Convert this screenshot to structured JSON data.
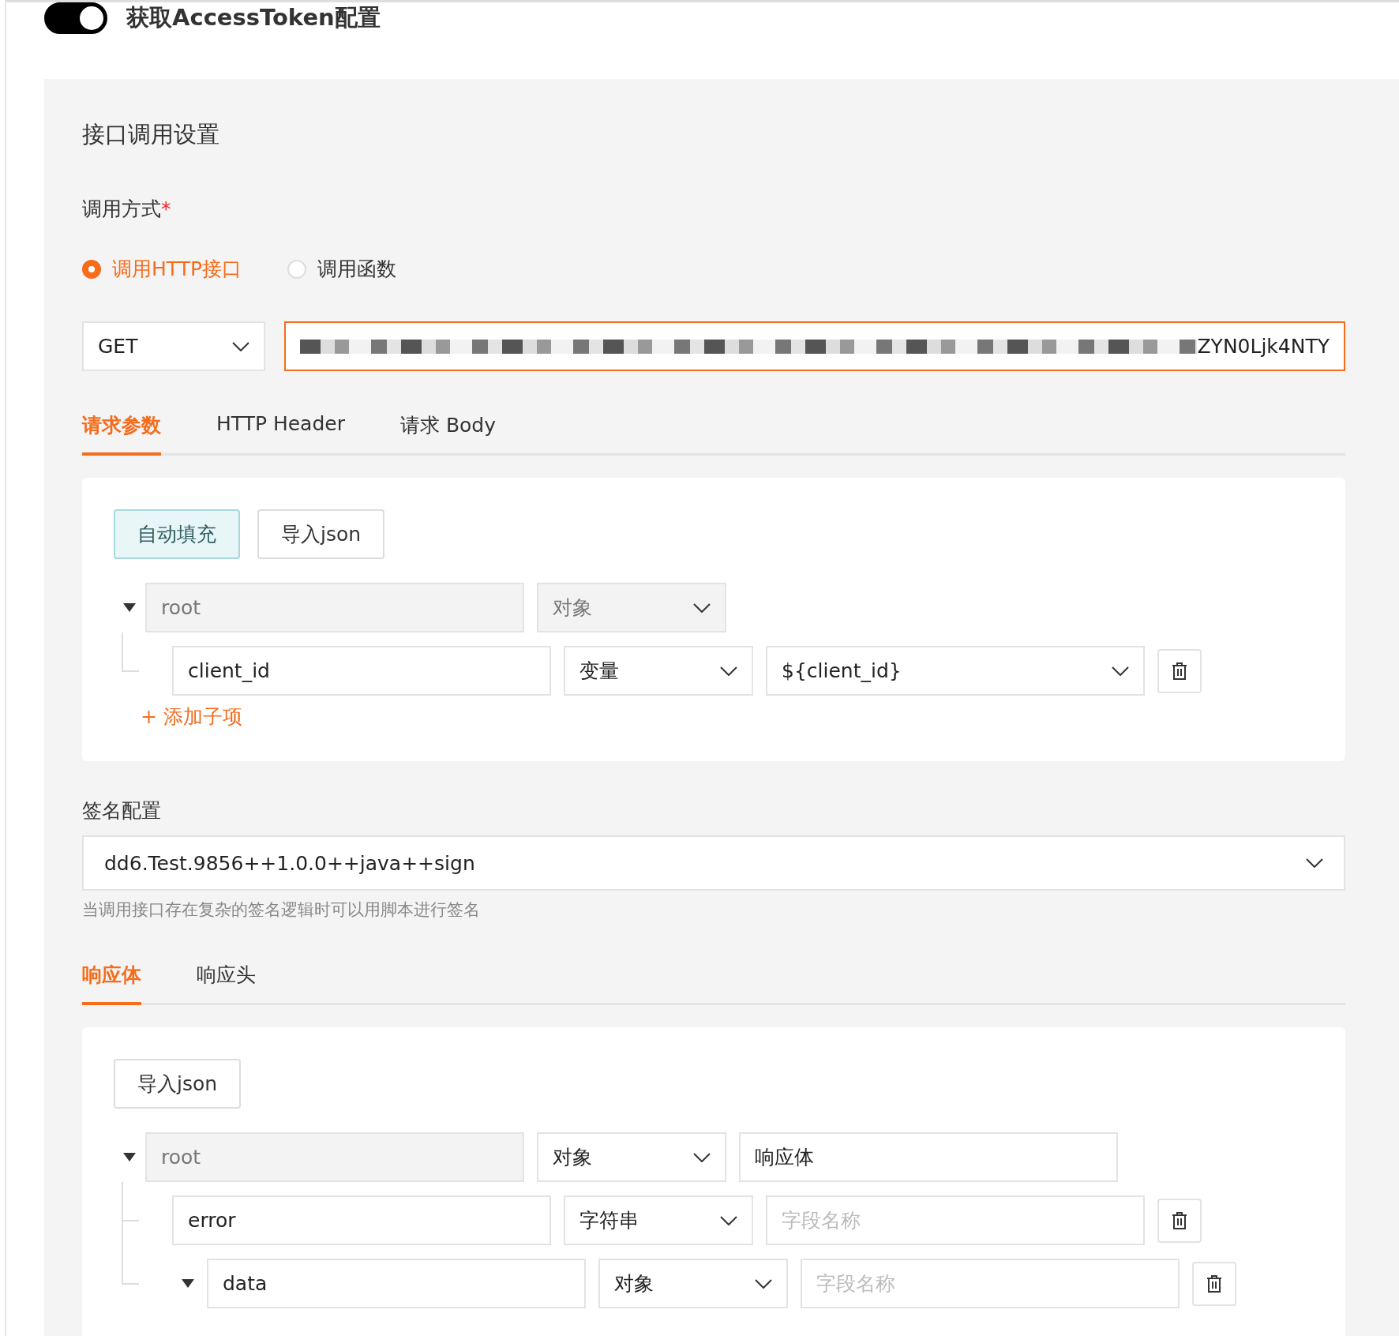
{
  "toggle": {
    "on": true,
    "label": "获取AccessToken配置"
  },
  "panel": {
    "title": "接口调用设置",
    "call_mode": {
      "label": "调用方式",
      "required_mark": "*",
      "options": [
        {
          "label": "调用HTTP接口",
          "selected": true
        },
        {
          "label": "调用函数",
          "selected": false
        }
      ]
    },
    "method": "GET",
    "url": {
      "value": "ZYN0Ljk4NTY",
      "focused": true
    },
    "request_tabs": [
      {
        "label": "请求参数",
        "selected": true
      },
      {
        "label": "HTTP Header",
        "selected": false
      },
      {
        "label": "请求 Body",
        "selected": false
      }
    ],
    "request_params": {
      "buttons": [
        {
          "label": "自动填充",
          "kind": "primary"
        },
        {
          "label": "导入json",
          "kind": "default"
        }
      ],
      "tree": {
        "name": "root",
        "name_disabled": true,
        "type": "对象",
        "type_disabled": true,
        "expanded": true,
        "children": [
          {
            "name": "client_id",
            "type": "变量",
            "selected_value": "${client_id}"
          }
        ]
      },
      "add_child": "+ 添加子项"
    },
    "signature": {
      "label": "签名配置",
      "value": "dd6.Test.9856++1.0.0++java++sign",
      "hint": "当调用接口存在复杂的签名逻辑时可以用脚本进行签名"
    },
    "response_tabs": [
      {
        "label": "响应体",
        "selected": true
      },
      {
        "label": "响应头",
        "selected": false
      }
    ],
    "response_body": {
      "buttons": [
        {
          "label": "导入json",
          "kind": "default"
        }
      ],
      "tree": {
        "name": "root",
        "name_disabled": true,
        "type": "对象",
        "type_disabled": false,
        "value": "响应体",
        "expanded": true,
        "children": [
          {
            "name": "error",
            "type": "字符串",
            "placeholder": "字段名称"
          },
          {
            "name": "data",
            "type": "对象",
            "placeholder": "字段名称",
            "expanded": true
          }
        ]
      }
    }
  }
}
